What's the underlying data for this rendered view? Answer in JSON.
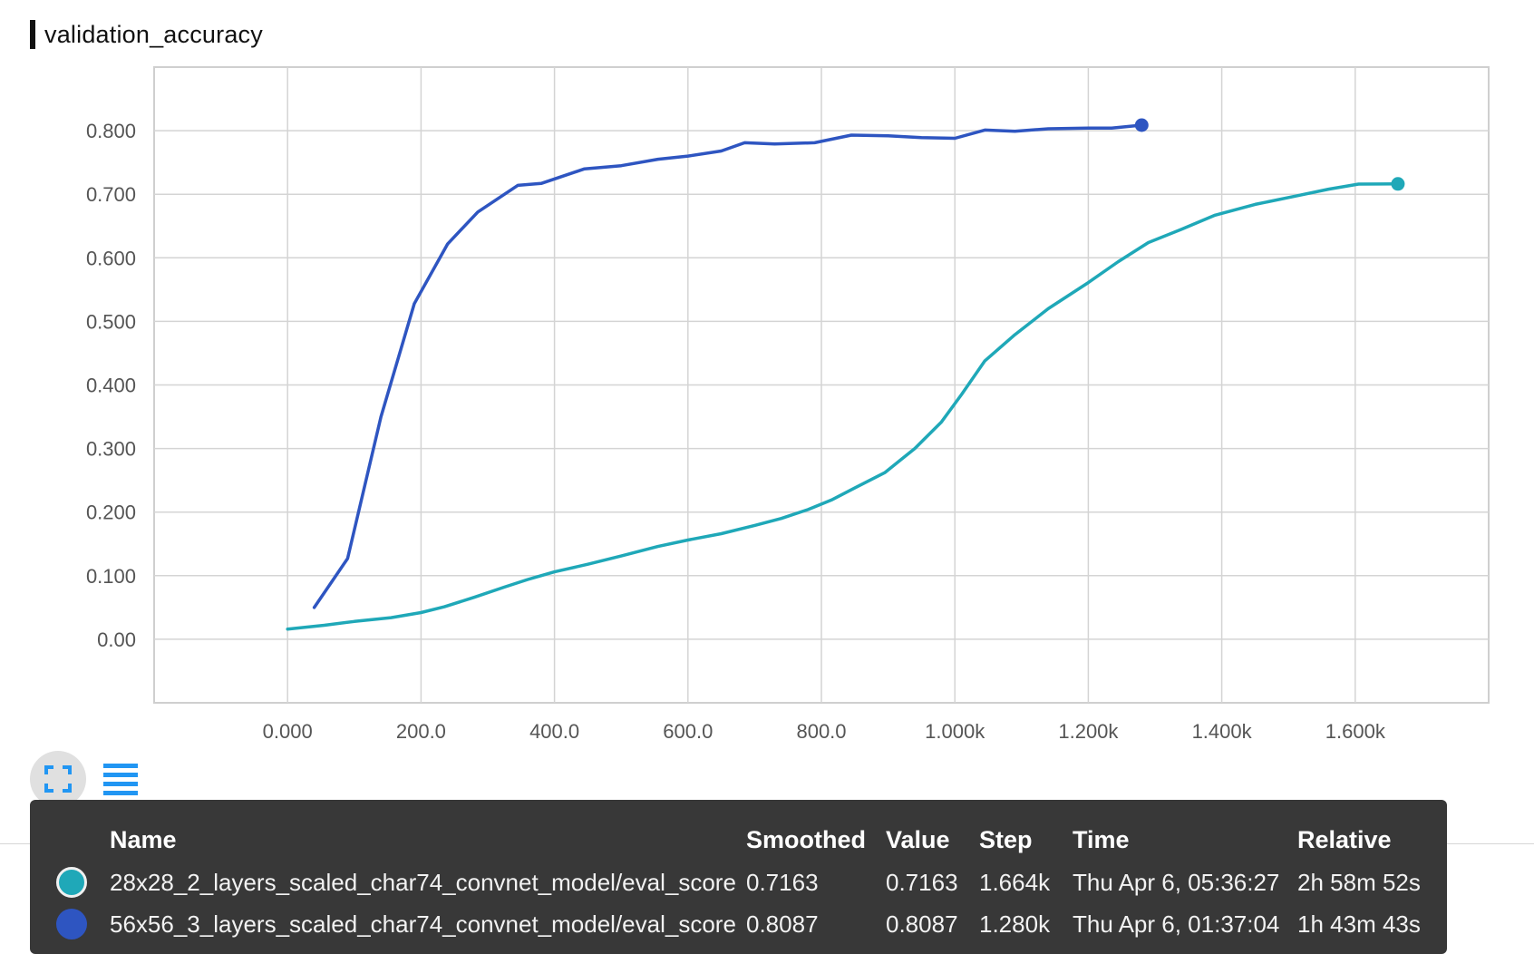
{
  "title": "validation_accuracy",
  "chart_data": {
    "type": "line",
    "title": "validation_accuracy",
    "xlabel": "",
    "ylabel": "",
    "xlim": [
      -200,
      1800
    ],
    "ylim": [
      -0.1,
      0.9
    ],
    "grid": true,
    "x_tick_labels": [
      {
        "value": 0,
        "label": "0.000"
      },
      {
        "value": 200,
        "label": "200.0"
      },
      {
        "value": 400,
        "label": "400.0"
      },
      {
        "value": 600,
        "label": "600.0"
      },
      {
        "value": 800,
        "label": "800.0"
      },
      {
        "value": 1000,
        "label": "1.000k"
      },
      {
        "value": 1200,
        "label": "1.200k"
      },
      {
        "value": 1400,
        "label": "1.400k"
      },
      {
        "value": 1600,
        "label": "1.600k"
      }
    ],
    "y_tick_labels": [
      {
        "value": 0.0,
        "label": "0.00"
      },
      {
        "value": 0.1,
        "label": "0.100"
      },
      {
        "value": 0.2,
        "label": "0.200"
      },
      {
        "value": 0.3,
        "label": "0.300"
      },
      {
        "value": 0.4,
        "label": "0.400"
      },
      {
        "value": 0.5,
        "label": "0.500"
      },
      {
        "value": 0.6,
        "label": "0.600"
      },
      {
        "value": 0.7,
        "label": "0.700"
      },
      {
        "value": 0.8,
        "label": "0.800"
      }
    ],
    "series": [
      {
        "name": "28x28_2_layers_scaled_char74_convnet_model/eval_score",
        "color": "#1fa8b8",
        "points": [
          [
            0,
            0.016
          ],
          [
            55,
            0.022
          ],
          [
            100,
            0.028
          ],
          [
            155,
            0.034
          ],
          [
            200,
            0.042
          ],
          [
            235,
            0.051
          ],
          [
            280,
            0.066
          ],
          [
            325,
            0.082
          ],
          [
            360,
            0.094
          ],
          [
            400,
            0.106
          ],
          [
            450,
            0.118
          ],
          [
            500,
            0.131
          ],
          [
            555,
            0.146
          ],
          [
            600,
            0.156
          ],
          [
            650,
            0.166
          ],
          [
            700,
            0.179
          ],
          [
            740,
            0.19
          ],
          [
            780,
            0.204
          ],
          [
            815,
            0.219
          ],
          [
            850,
            0.238
          ],
          [
            895,
            0.262
          ],
          [
            940,
            0.3
          ],
          [
            980,
            0.342
          ],
          [
            1010,
            0.385
          ],
          [
            1045,
            0.438
          ],
          [
            1090,
            0.479
          ],
          [
            1140,
            0.52
          ],
          [
            1200,
            0.561
          ],
          [
            1245,
            0.594
          ],
          [
            1290,
            0.624
          ],
          [
            1340,
            0.645
          ],
          [
            1390,
            0.667
          ],
          [
            1450,
            0.684
          ],
          [
            1510,
            0.697
          ],
          [
            1560,
            0.708
          ],
          [
            1605,
            0.716
          ],
          [
            1664,
            0.7163
          ]
        ]
      },
      {
        "name": "56x56_3_layers_scaled_char74_convnet_model/eval_score",
        "color": "#2e55c1",
        "points": [
          [
            40,
            0.05
          ],
          [
            90,
            0.127
          ],
          [
            140,
            0.35
          ],
          [
            190,
            0.528
          ],
          [
            240,
            0.622
          ],
          [
            285,
            0.672
          ],
          [
            345,
            0.714
          ],
          [
            380,
            0.717
          ],
          [
            445,
            0.74
          ],
          [
            500,
            0.745
          ],
          [
            555,
            0.755
          ],
          [
            600,
            0.76
          ],
          [
            650,
            0.768
          ],
          [
            685,
            0.781
          ],
          [
            730,
            0.779
          ],
          [
            790,
            0.781
          ],
          [
            845,
            0.793
          ],
          [
            900,
            0.792
          ],
          [
            950,
            0.789
          ],
          [
            1000,
            0.788
          ],
          [
            1045,
            0.801
          ],
          [
            1090,
            0.799
          ],
          [
            1140,
            0.803
          ],
          [
            1200,
            0.804
          ],
          [
            1235,
            0.804
          ],
          [
            1280,
            0.8087
          ]
        ]
      }
    ]
  },
  "tooltip": {
    "headers": {
      "name": "Name",
      "smoothed": "Smoothed",
      "value": "Value",
      "step": "Step",
      "time": "Time",
      "relative": "Relative"
    },
    "rows": [
      {
        "color": "#1fa8b8",
        "name": "28x28_2_layers_scaled_char74_convnet_model/eval_score",
        "smoothed": "0.7163",
        "value": "0.7163",
        "step": "1.664k",
        "time": "Thu Apr 6, 05:36:27",
        "relative": "2h 58m 52s"
      },
      {
        "color": "#2e55c1",
        "name": "56x56_3_layers_scaled_char74_convnet_model/eval_score",
        "smoothed": "0.8087",
        "value": "0.8087",
        "step": "1.280k",
        "time": "Thu Apr 6, 01:37:04",
        "relative": "1h 43m 43s"
      }
    ]
  },
  "icons": {
    "expand": "expand-fullscreen-icon",
    "list": "list-lines-icon"
  }
}
